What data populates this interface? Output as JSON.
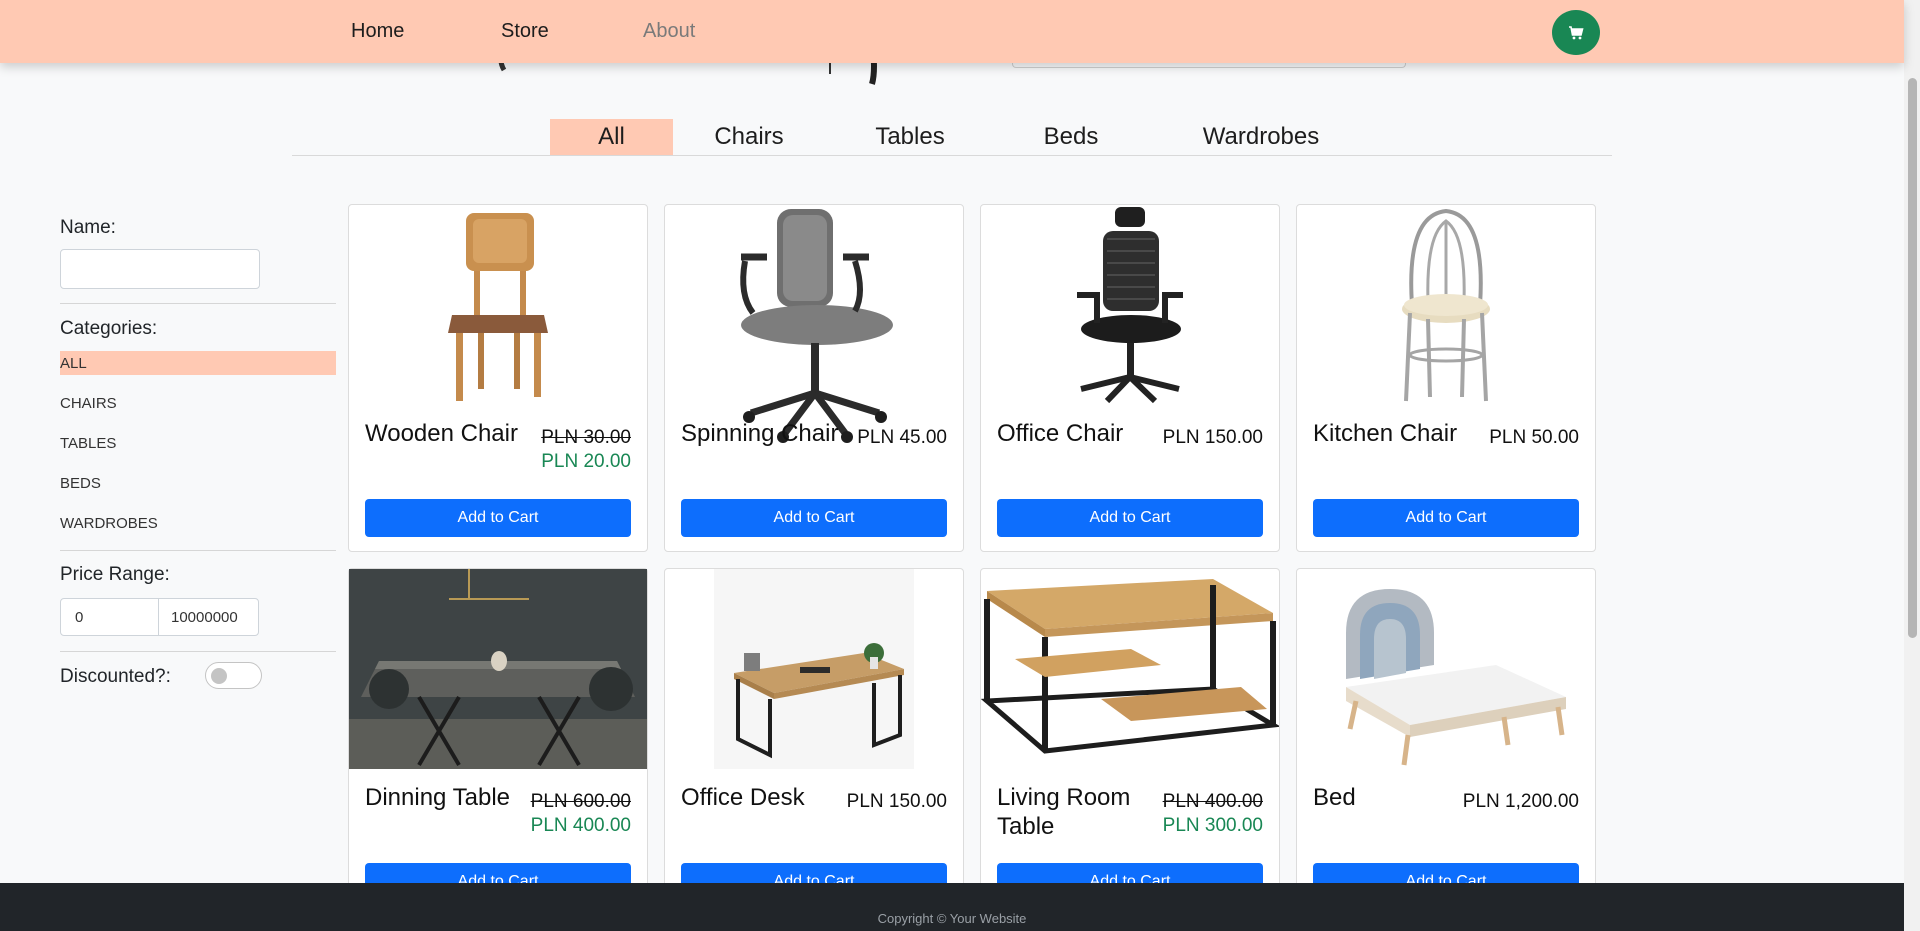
{
  "nav": {
    "home": "Home",
    "store": "Store",
    "about": "About",
    "cart_icon": "cart-icon"
  },
  "tabs": [
    "All",
    "Chairs",
    "Tables",
    "Beds",
    "Wardrobes"
  ],
  "sidebar": {
    "name_label": "Name:",
    "name_value": "",
    "categories_label": "Categories:",
    "categories": [
      "ALL",
      "CHAIRS",
      "TABLES",
      "BEDS",
      "WARDROBES"
    ],
    "price_label": "Price Range:",
    "price_min": "0",
    "price_max": "10000000",
    "discount_label": "Discounted?:",
    "discount_on": false
  },
  "products": [
    {
      "name": "Wooden Chair",
      "price": "PLN 30.00",
      "sale_price": "PLN 20.00",
      "button": "Add to Cart"
    },
    {
      "name": "Spinning Chair",
      "price": "PLN 45.00",
      "sale_price": null,
      "button": "Add to Cart"
    },
    {
      "name": "Office Chair",
      "price": "PLN 150.00",
      "sale_price": null,
      "button": "Add to Cart"
    },
    {
      "name": "Kitchen Chair",
      "price": "PLN 50.00",
      "sale_price": null,
      "button": "Add to Cart"
    },
    {
      "name": "Dinning Table",
      "price": "PLN 600.00",
      "sale_price": "PLN 400.00",
      "button": "Add to Cart"
    },
    {
      "name": "Office Desk",
      "price": "PLN 150.00",
      "sale_price": null,
      "button": "Add to Cart"
    },
    {
      "name": "Living Room Table",
      "price": "PLN 400.00",
      "sale_price": "PLN 300.00",
      "button": "Add to Cart"
    },
    {
      "name": "Bed",
      "price": "PLN 1,200.00",
      "sale_price": null,
      "button": "Add to Cart"
    }
  ],
  "footer": {
    "copyright": "Copyright © Your Website"
  },
  "colors": {
    "accent": "#ffc9b3",
    "primary": "#0d6efd",
    "success": "#198754",
    "footer": "#212529"
  }
}
